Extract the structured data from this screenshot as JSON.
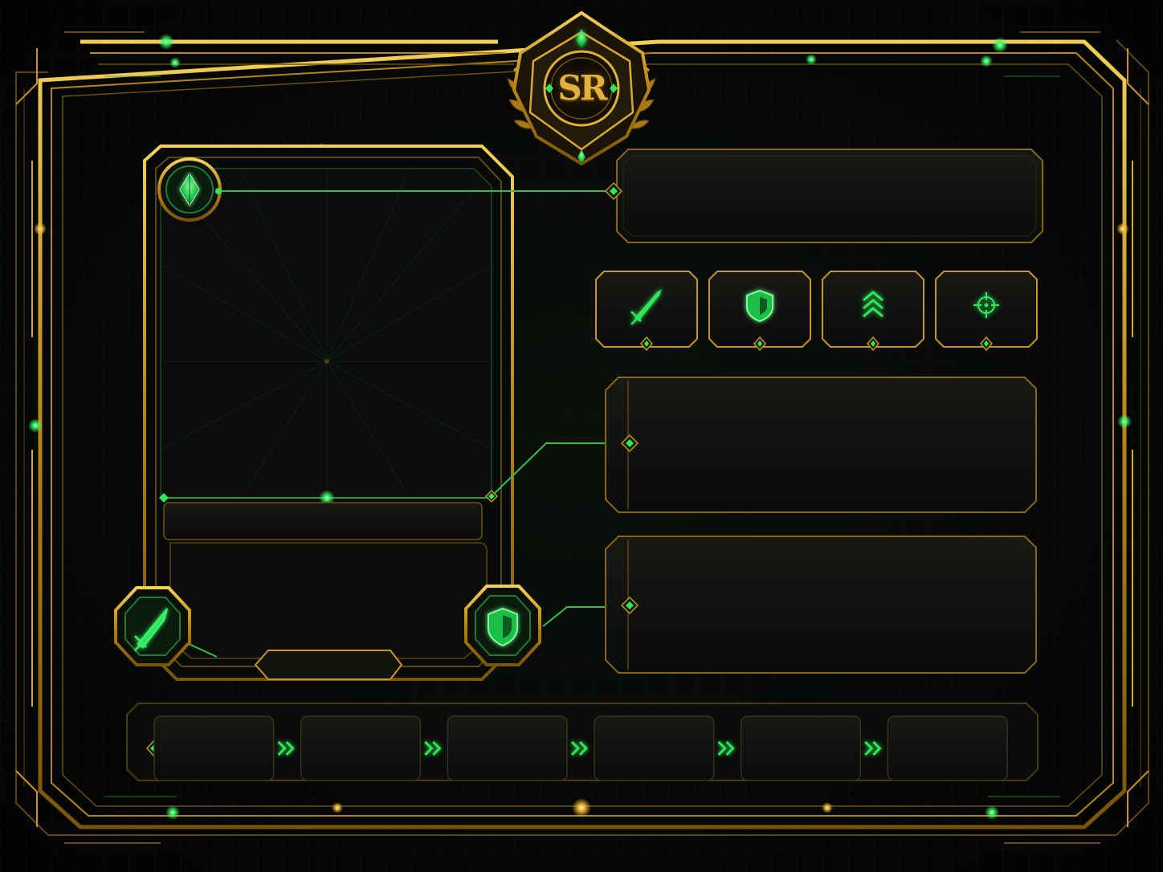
{
  "badge": {
    "monogram": "SR",
    "icon": "rank-emblem-icon"
  },
  "colors": {
    "background": "#040604",
    "gold": "#c9961f",
    "gold_light": "#f0c24a",
    "green": "#2ee85a",
    "green_dim": "#1e7a32",
    "panel": "#0e0f0d"
  },
  "portrait_card": {
    "gem_icon": "emerald-gem-icon",
    "attack_icon": "sword-icon",
    "defense_icon": "shield-icon"
  },
  "stat_buttons": [
    {
      "id": "attack",
      "icon": "sword-icon"
    },
    {
      "id": "defense",
      "icon": "shield-icon"
    },
    {
      "id": "rank",
      "icon": "chevron-stack-icon"
    },
    {
      "id": "precision",
      "icon": "crosshair-icon"
    }
  ],
  "progression": {
    "connector_icon": "double-chevron-right-icon",
    "slot_count": 6
  }
}
